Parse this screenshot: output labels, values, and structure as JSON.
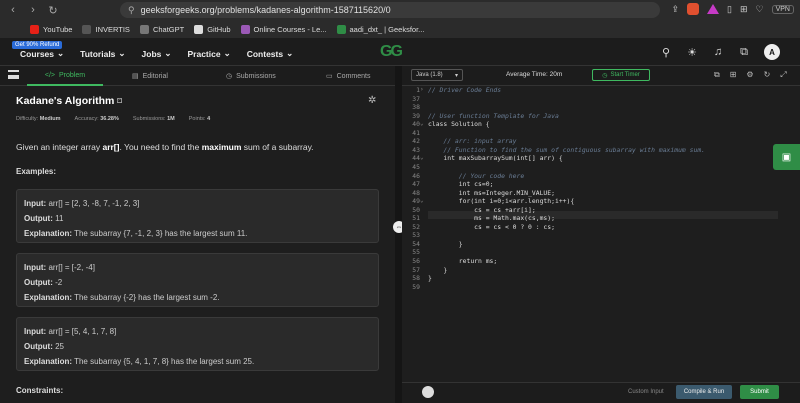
{
  "browser": {
    "url": "geeksforgeeks.org/problems/kadanes-algorithm-1587115620/0",
    "vpn_label": "VPN",
    "bookmarks": [
      {
        "label": "YouTube",
        "color": "#e62117"
      },
      {
        "label": "INVERTIS",
        "color": "#555555"
      },
      {
        "label": "ChatGPT",
        "color": "#777777"
      },
      {
        "label": "GitHub",
        "color": "#dddddd"
      },
      {
        "label": "Online Courses - Le...",
        "color": "#9b59b6"
      },
      {
        "label": "aadi_dxt_ | Geeksfor...",
        "color": "#2f8d46"
      }
    ]
  },
  "nav": {
    "promo": "Get 90% Refund",
    "items": [
      "Courses",
      "Tutorials",
      "Jobs",
      "Practice",
      "Contests"
    ],
    "logo": "GG",
    "avatar": "A"
  },
  "tabs": {
    "problem": "Problem",
    "editorial": "Editorial",
    "submissions": "Submissions",
    "comments": "Comments"
  },
  "problem": {
    "title": "Kadane's Algorithm",
    "difficulty_label": "Difficulty:",
    "difficulty": "Medium",
    "accuracy_label": "Accuracy:",
    "accuracy": "36.28%",
    "submissions_label": "Submissions:",
    "submissions": "1M",
    "points_label": "Points:",
    "points": "4",
    "desc_pre": "Given an integer array ",
    "desc_arr": "arr[]",
    "desc_mid": ". You need to find the ",
    "desc_max": "maximum",
    "desc_post": " sum of a subarray.",
    "examples_heading": "Examples:",
    "constraints_heading": "Constraints:",
    "examples": [
      {
        "input": "arr[] = [2, 3, -8, 7, -1, 2, 3]",
        "output": "11",
        "explanation": "The subarray {7, -1, 2, 3} has the largest sum 11."
      },
      {
        "input": "arr[] = [-2, -4]",
        "output": "-2",
        "explanation": "The subarray {-2} has the largest sum -2."
      },
      {
        "input": "arr[] = [5, 4, 1, 7, 8]",
        "output": "25",
        "explanation": "The subarray {5, 4, 1, 7, 8} has the largest sum 25."
      }
    ],
    "labels": {
      "input": "Input:",
      "output": "Output:",
      "explanation": "Explanation:"
    }
  },
  "editor": {
    "language": "Java (1.8)",
    "avg_time": "Average Time: 20m",
    "timer": "Start Timer",
    "custom_input": "Custom Input",
    "compile": "Compile & Run",
    "submit": "Submit",
    "lines": [
      {
        "n": "1",
        "text": "// Driver Code Ends",
        "type": "cm",
        "fold": "›"
      },
      {
        "n": "37",
        "text": "",
        "type": "",
        "fold": ""
      },
      {
        "n": "38",
        "text": "",
        "type": "",
        "fold": ""
      },
      {
        "n": "39",
        "text": "// User function Template for Java",
        "type": "cm",
        "fold": ""
      },
      {
        "n": "40",
        "text": "class Solution {",
        "type": "",
        "fold": "⌄"
      },
      {
        "n": "41",
        "text": "",
        "type": "",
        "fold": ""
      },
      {
        "n": "42",
        "text": "    // arr: input array",
        "type": "cm",
        "fold": ""
      },
      {
        "n": "43",
        "text": "    // Function to find the sum of contiguous subarray with maximum sum.",
        "type": "cm",
        "fold": ""
      },
      {
        "n": "44",
        "text": "    int maxSubarraySum(int[] arr) {",
        "type": "",
        "fold": "⌄"
      },
      {
        "n": "45",
        "text": "",
        "type": "",
        "fold": ""
      },
      {
        "n": "46",
        "text": "        // Your code here",
        "type": "cm",
        "fold": ""
      },
      {
        "n": "47",
        "text": "        int cs=0;",
        "type": "",
        "fold": ""
      },
      {
        "n": "48",
        "text": "        int ms=Integer.MIN_VALUE;",
        "type": "",
        "fold": ""
      },
      {
        "n": "49",
        "text": "        for(int i=0;i<arr.length;i++){",
        "type": "",
        "fold": "⌄"
      },
      {
        "n": "50",
        "text": "            cs = cs +arr[i];",
        "type": "",
        "fold": ""
      },
      {
        "n": "51",
        "text": "            ms = Math.max(cs,ms);",
        "type": "",
        "fold": ""
      },
      {
        "n": "52",
        "text": "            cs = cs < 0 ? 0 : cs;",
        "type": "",
        "fold": ""
      },
      {
        "n": "53",
        "text": "",
        "type": "",
        "fold": ""
      },
      {
        "n": "54",
        "text": "        }",
        "type": "",
        "fold": ""
      },
      {
        "n": "55",
        "text": "",
        "type": "",
        "fold": ""
      },
      {
        "n": "56",
        "text": "        return ms;",
        "type": "",
        "fold": ""
      },
      {
        "n": "57",
        "text": "    }",
        "type": "",
        "fold": ""
      },
      {
        "n": "58",
        "text": "}",
        "type": "",
        "fold": ""
      },
      {
        "n": "59",
        "text": "",
        "type": "",
        "fold": ""
      }
    ]
  }
}
